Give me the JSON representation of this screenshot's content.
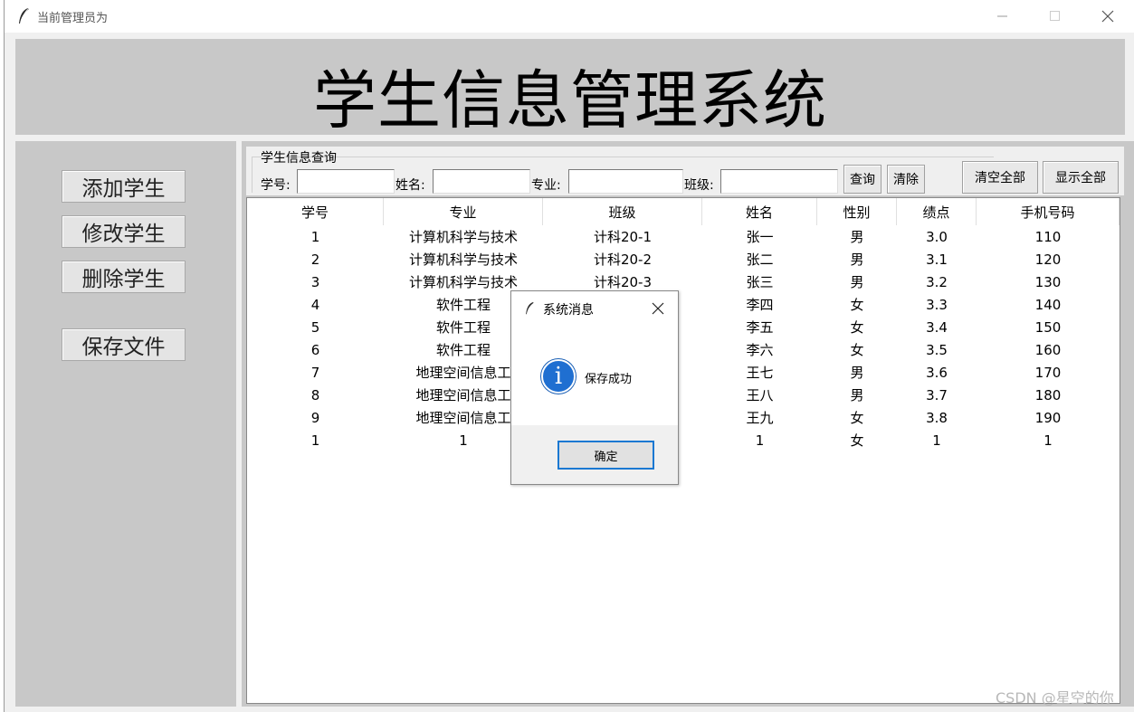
{
  "window": {
    "title": "当前管理员为"
  },
  "header": {
    "title": "学生信息管理系统"
  },
  "sidebar": {
    "add_label": "添加学生",
    "edit_label": "修改学生",
    "delete_label": "删除学生",
    "save_label": "保存文件"
  },
  "query": {
    "legend": "学生信息查询",
    "id_label": "学号:",
    "name_label": "姓名:",
    "major_label": "专业:",
    "class_label": "班级:",
    "search_label": "查询",
    "clear_label": "清除",
    "clear_all_label": "清空全部",
    "show_all_label": "显示全部"
  },
  "table": {
    "columns": [
      "学号",
      "专业",
      "班级",
      "姓名",
      "性别",
      "绩点",
      "手机号码"
    ],
    "rows": [
      [
        "1",
        "计算机科学与技术",
        "计科20-1",
        "张一",
        "男",
        "3.0",
        "110"
      ],
      [
        "2",
        "计算机科学与技术",
        "计科20-2",
        "张二",
        "男",
        "3.1",
        "120"
      ],
      [
        "3",
        "计算机科学与技术",
        "计科20-3",
        "张三",
        "男",
        "3.2",
        "130"
      ],
      [
        "4",
        "软件工程",
        "",
        "李四",
        "女",
        "3.3",
        "140"
      ],
      [
        "5",
        "软件工程",
        "",
        "李五",
        "女",
        "3.4",
        "150"
      ],
      [
        "6",
        "软件工程",
        "",
        "李六",
        "女",
        "3.5",
        "160"
      ],
      [
        "7",
        "地理空间信息工",
        "",
        "王七",
        "男",
        "3.6",
        "170"
      ],
      [
        "8",
        "地理空间信息工",
        "",
        "王八",
        "男",
        "3.7",
        "180"
      ],
      [
        "9",
        "地理空间信息工",
        "",
        "王九",
        "女",
        "3.8",
        "190"
      ],
      [
        "1",
        "1",
        "",
        "1",
        "女",
        "1",
        "1"
      ]
    ]
  },
  "dialog": {
    "title": "系统消息",
    "message": "保存成功",
    "ok_label": "确定",
    "icon": "info-icon"
  },
  "watermark": "CSDN @星空的你"
}
